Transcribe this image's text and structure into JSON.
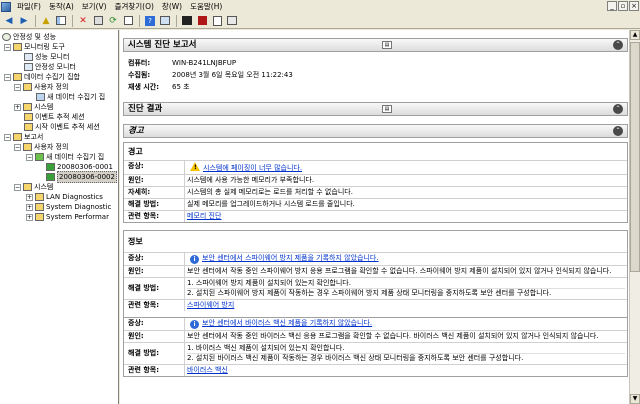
{
  "menu": [
    "파일(F)",
    "동작(A)",
    "보기(V)",
    "즐겨찾기(O)",
    "창(W)",
    "도움말(H)"
  ],
  "window_buttons": [
    "_",
    "▫",
    "×"
  ],
  "toolbar_icons": [
    "back-icon",
    "forward-icon",
    "up-icon",
    "show-hide-tree-icon",
    "delete-icon",
    "properties-icon",
    "refresh-icon",
    "export-icon",
    "help-icon",
    "console-icon",
    "start-icon",
    "stop-icon",
    "report-icon",
    "view-icon"
  ],
  "tree": {
    "root": "안정성 및 성능",
    "monitor_tools": "모니터링 도구",
    "perf_monitor": "성능 모니터",
    "reliability_monitor": "안정성 모니터",
    "data_collector_sets": "데이터 수집기 집합",
    "user_defined": "사용자 정의",
    "new_set": "새 데이터 수집기 집",
    "system": "시스템",
    "event_trace": "이벤트 추적 세션",
    "startup_trace": "시작 이벤트 추적 세션",
    "reports": "보고서",
    "rpt_user_defined": "사용자 정의",
    "rpt_new_set": "새 데이터 수집기 집",
    "report1": "20080306-0001",
    "report2": "20080306-0002",
    "rpt_system": "시스템",
    "lan": "LAN Diagnostics",
    "sysdiag": "System Diagnostic",
    "sysperf": "System Performar"
  },
  "report": {
    "title": "시스템 진단 보고서",
    "computer_label": "컴퓨터:",
    "computer_value": "WIN-B241LNJBFUP",
    "collected_label": "수집됨:",
    "collected_value": "2008년 3월 6일 목요일 오전 11:22:43",
    "duration_label": "재생 시간:",
    "duration_value": "65 초",
    "results_title": "진단 결과",
    "warnings_header": "경고"
  },
  "warning_panel": {
    "title": "경고",
    "symptom_label": "증상:",
    "symptom": "시스템에 페이징이 너무 많습니다.",
    "cause_label": "원인:",
    "cause": "시스템에 사용 가능한 메모리가 부족합니다.",
    "details_label": "자세히:",
    "details": "시스템의 총 실제 메모리로는 로드를 처리할 수 없습니다.",
    "resolution_label": "해결 방법:",
    "resolution": "실제 메모리를 업그레이드하거나 시스템 로드를 줄입니다.",
    "related_label": "관련 항목:",
    "related": "메모리 진단"
  },
  "info_panel": {
    "title": "정보",
    "symptom_label": "증상:",
    "cause_label": "원인:",
    "resolution_label": "해결 방법:",
    "related_label": "관련 항목:",
    "item1": {
      "symptom": "보안 센터에서 스파이웨어 방지 제품을 기록하지 않았습니다.",
      "cause": "보안 센터에서 작동 중인 스파이웨어 방지 응용 프로그램을 확인할 수 없습니다. 스파이웨어 방지 제품이 설치되어 있지 않거나 인식되지 않습니다.",
      "res1": "1. 스파이웨어 방지 제품이 설치되어 있는지 확인합니다.",
      "res2": "2. 설치된 스파이웨어 방지 제품이 작동하는 경우 스파이웨어 방지 제품 상태 모니터링을 중지하도록 보안 센터를 구성합니다.",
      "related": "스파이웨어 방지"
    },
    "item2": {
      "symptom": "보안 센터에서 바이러스 백신 제품을 기록하지 않았습니다.",
      "cause": "보안 센터에서 작동 중인 바이러스 백신 응용 프로그램을 확인할 수 없습니다. 바이러스 백신 제품이 설치되어 있지 않거나 인식되지 않습니다.",
      "res1": "1. 바이러스 백신 제품이 설치되어 있는지 확인합니다.",
      "res2": "2. 설치된 바이러스 백신 제품이 작동하는 경우 바이러스 백신 상태 모니터링을 중지하도록 보안 센터를 구성합니다.",
      "related": "바이러스 백신"
    }
  }
}
